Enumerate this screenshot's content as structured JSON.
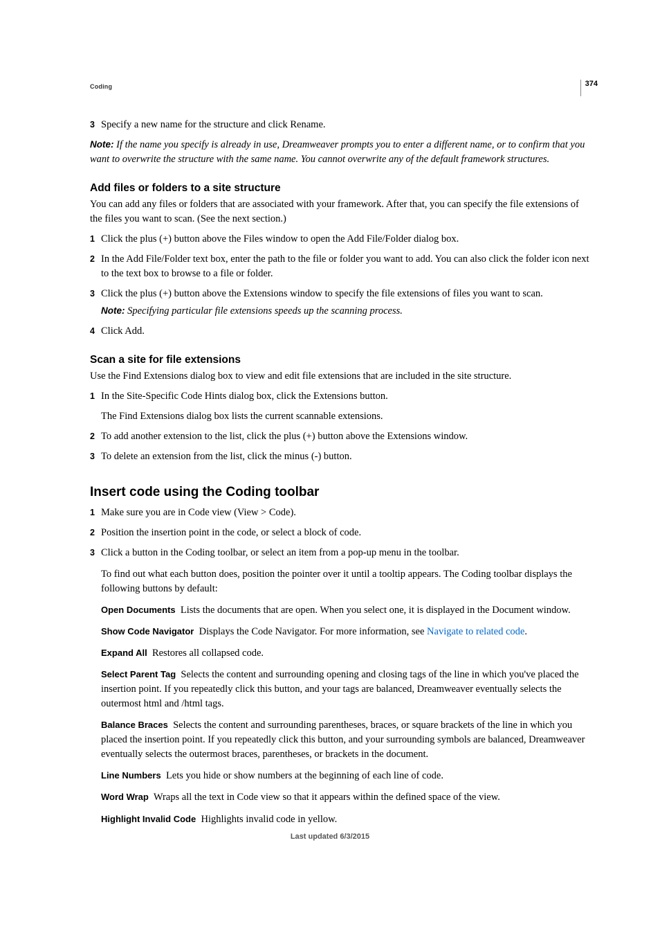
{
  "pageNumber": "374",
  "headerLabel": "Coding",
  "step3_top": "Specify a new name for the structure and click Rename.",
  "note_top": {
    "label": "Note:",
    "text": "If the name you specify is already in use, Dreamweaver prompts you to enter a different name, or to confirm that you want to overwrite the structure with the same name. You cannot overwrite any of the default framework structures."
  },
  "addFiles": {
    "heading": "Add files or folders to a site structure",
    "intro": "You can add any files or folders that are associated with your framework. After that, you can specify the file extensions of the files you want to scan. (See the next section.)",
    "steps": [
      "Click the plus (+) button above the Files window to open the Add File/Folder dialog box.",
      "In the Add File/Folder text box, enter the path to the file or folder you want to add. You can also click the folder icon next to the text box to browse to a file or folder.",
      "Click the plus (+) button above the Extensions window to specify the file extensions of files you want to scan."
    ],
    "note": {
      "label": "Note:",
      "text": "Specifying particular file extensions speeds up the scanning process."
    },
    "step4": "Click Add."
  },
  "scanSite": {
    "heading": "Scan a site for file extensions",
    "intro": "Use the Find Extensions dialog box to view and edit file extensions that are included in the site structure.",
    "step1": "In the Site-Specific Code Hints dialog box, click the Extensions button.",
    "step1b": "The Find Extensions dialog box lists the current scannable extensions.",
    "step2": "To add another extension to the list, click the plus (+) button above the Extensions window.",
    "step3": "To delete an extension from the list, click the minus (-) button."
  },
  "insertCode": {
    "heading": "Insert code using the Coding toolbar",
    "step1": "Make sure you are in Code view (View > Code).",
    "step2": "Position the insertion point in the code, or select a block of code.",
    "step3": "Click a button in the Coding toolbar, or select an item from a pop-up menu in the toolbar.",
    "step3b": "To find out what each button does, position the pointer over it until a tooltip appears. The Coding toolbar displays the following buttons by default:",
    "defs": {
      "openDocuments": {
        "label": "Open Documents",
        "text": "Lists the documents that are open. When you select one, it is displayed in the Document window."
      },
      "showCodeNav": {
        "label": "Show Code Navigator",
        "text_pre": "Displays the Code Navigator. For more information, see ",
        "link": "Navigate to related code",
        "text_post": "."
      },
      "expandAll": {
        "label": "Expand All",
        "text": "Restores all collapsed code."
      },
      "selectParent": {
        "label": "Select Parent Tag",
        "text": "Selects the content and surrounding opening and closing tags of the line in which you've placed the insertion point. If you repeatedly click this button, and your tags are balanced, Dreamweaver eventually selects the outermost html and /html tags."
      },
      "balanceBraces": {
        "label": "Balance Braces",
        "text": "Selects the content and surrounding parentheses, braces, or square brackets of the line in which you placed the insertion point. If you repeatedly click this button, and your surrounding symbols are balanced, Dreamweaver eventually selects the outermost braces, parentheses, or brackets in the document."
      },
      "lineNumbers": {
        "label": "Line Numbers",
        "text": "Lets you hide or show numbers at the beginning of each line of code."
      },
      "wordWrap": {
        "label": "Word Wrap",
        "text": "Wraps all the text in Code view so that it appears within the defined space of the view."
      },
      "highlightInvalid": {
        "label": "Highlight Invalid Code",
        "text": "Highlights invalid code in yellow."
      }
    }
  },
  "footer": "Last updated 6/3/2015",
  "nums": {
    "n1": "1",
    "n2": "2",
    "n3": "3",
    "n4": "4"
  }
}
